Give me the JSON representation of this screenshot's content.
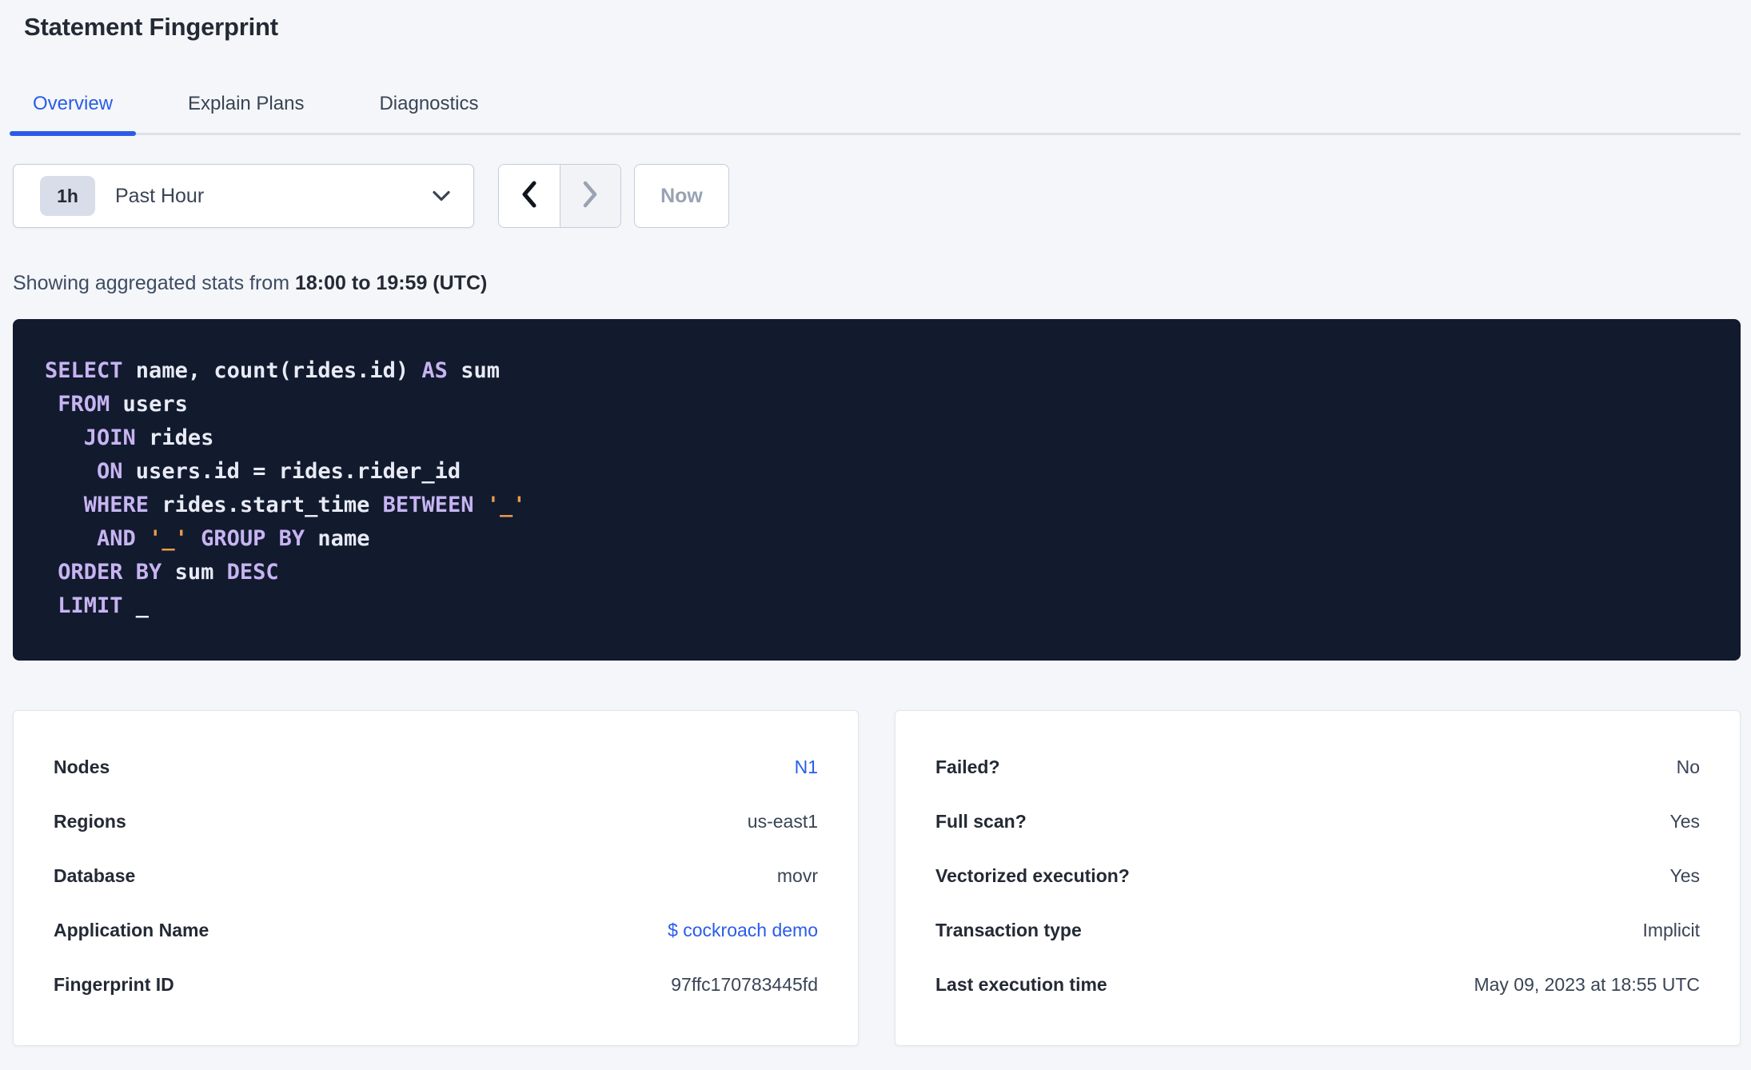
{
  "page_title": "Statement Fingerprint",
  "tabs": [
    {
      "label": "Overview",
      "active": true
    },
    {
      "label": "Explain Plans",
      "active": false
    },
    {
      "label": "Diagnostics",
      "active": false
    }
  ],
  "time_controls": {
    "interval_badge": "1h",
    "selected_range": "Past Hour",
    "now_button": "Now"
  },
  "stats_line": {
    "prefix": "Showing aggregated stats from ",
    "range_bold": "18:00 to 19:59 (UTC)"
  },
  "sql": {
    "lines": [
      [
        {
          "t": "SELECT",
          "c": "kw"
        },
        {
          "t": " name, count(rides.id) ",
          "c": "pl"
        },
        {
          "t": "AS",
          "c": "kw"
        },
        {
          "t": " sum",
          "c": "pl"
        }
      ],
      [
        {
          "t": " ",
          "c": "pl"
        },
        {
          "t": "FROM",
          "c": "kw"
        },
        {
          "t": " users",
          "c": "pl"
        }
      ],
      [
        {
          "t": "   ",
          "c": "pl"
        },
        {
          "t": "JOIN",
          "c": "kw"
        },
        {
          "t": " rides",
          "c": "pl"
        }
      ],
      [
        {
          "t": "    ",
          "c": "pl"
        },
        {
          "t": "ON",
          "c": "kw"
        },
        {
          "t": " users.id = rides.rider_id",
          "c": "pl"
        }
      ],
      [
        {
          "t": "   ",
          "c": "pl"
        },
        {
          "t": "WHERE",
          "c": "kw"
        },
        {
          "t": " rides.start_time ",
          "c": "pl"
        },
        {
          "t": "BETWEEN",
          "c": "kw"
        },
        {
          "t": " ",
          "c": "pl"
        },
        {
          "t": "'_'",
          "c": "str"
        }
      ],
      [
        {
          "t": "    ",
          "c": "pl"
        },
        {
          "t": "AND",
          "c": "kw"
        },
        {
          "t": " ",
          "c": "pl"
        },
        {
          "t": "'_'",
          "c": "str"
        },
        {
          "t": " ",
          "c": "pl"
        },
        {
          "t": "GROUP BY",
          "c": "kw"
        },
        {
          "t": " name",
          "c": "pl"
        }
      ],
      [
        {
          "t": " ",
          "c": "pl"
        },
        {
          "t": "ORDER BY",
          "c": "kw"
        },
        {
          "t": " sum ",
          "c": "pl"
        },
        {
          "t": "DESC",
          "c": "kw"
        }
      ],
      [
        {
          "t": " ",
          "c": "pl"
        },
        {
          "t": "LIMIT",
          "c": "kw"
        },
        {
          "t": " _",
          "c": "pl"
        }
      ]
    ]
  },
  "summary_cards": {
    "left": {
      "rows": [
        {
          "label": "Nodes",
          "value": "N1",
          "is_link": true
        },
        {
          "label": "Regions",
          "value": "us-east1",
          "is_link": false
        },
        {
          "label": "Database",
          "value": "movr",
          "is_link": false
        },
        {
          "label": "Application Name",
          "value": "$ cockroach demo",
          "is_link": true
        },
        {
          "label": "Fingerprint ID",
          "value": "97ffc170783445fd",
          "is_link": false
        }
      ]
    },
    "right": {
      "rows": [
        {
          "label": "Failed?",
          "value": "No",
          "is_link": false
        },
        {
          "label": "Full scan?",
          "value": "Yes",
          "is_link": false
        },
        {
          "label": "Vectorized execution?",
          "value": "Yes",
          "is_link": false
        },
        {
          "label": "Transaction type",
          "value": "Implicit",
          "is_link": false
        },
        {
          "label": "Last execution time",
          "value": "May 09, 2023 at 18:55 UTC",
          "is_link": false
        }
      ]
    }
  },
  "colors": {
    "accent_blue": "#2A5CE8",
    "page_background": "#F4F6F9",
    "code_background": "#121A2E",
    "sql_keyword": "#C7B4F2",
    "sql_literal": "#E99B4A",
    "sql_plain": "#E8EBF4",
    "disabled_text": "#99A2B3"
  }
}
